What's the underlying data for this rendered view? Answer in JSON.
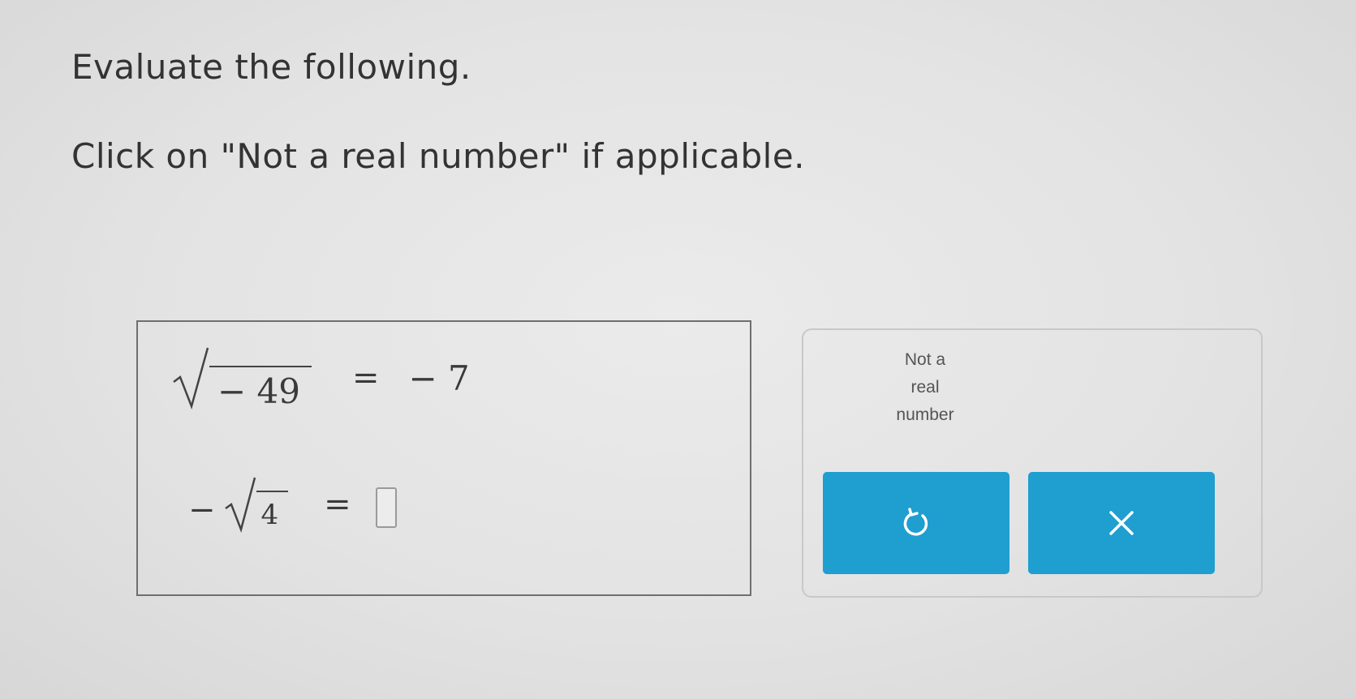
{
  "instructions": {
    "line1": "Evaluate the following.",
    "line2": "Click on \"Not a real number\" if applicable."
  },
  "problem": {
    "row1": {
      "radicand": "− 49",
      "equals": "=",
      "answer": "− 7"
    },
    "row2": {
      "negative": "−",
      "radicand": "4",
      "equals": "=",
      "answer_value": ""
    }
  },
  "keypad": {
    "not_real_line1": "Not a",
    "not_real_line2": "real",
    "not_real_line3": "number",
    "undo_icon": "undo-icon",
    "clear_icon": "close-icon",
    "button_color": "#1f9ed0"
  }
}
